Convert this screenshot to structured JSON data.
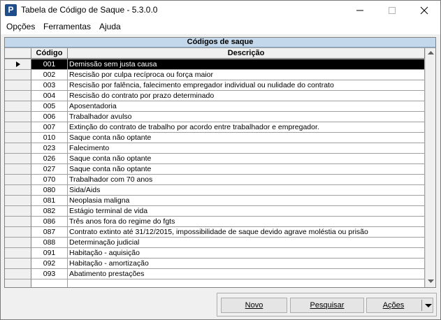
{
  "window": {
    "title": "Tabela de Código de Saque - 5.3.0.0",
    "icon": "app-logo-icon",
    "icon_letter": "P"
  },
  "menu": [
    {
      "label": "Opções"
    },
    {
      "label": "Ferramentas"
    },
    {
      "label": "Ajuda"
    }
  ],
  "grid": {
    "title": "Códigos de saque",
    "columns": {
      "code": "Código",
      "description": "Descrição"
    },
    "selected_index": 0,
    "rows": [
      {
        "code": "001",
        "description": "Demissão sem justa causa"
      },
      {
        "code": "002",
        "description": "Rescisão por culpa recíproca ou força maior"
      },
      {
        "code": "003",
        "description": "Rescisão por falência, falecimento empregador individual ou nulidade do contrato"
      },
      {
        "code": "004",
        "description": "Rescisão do contrato por prazo determinado"
      },
      {
        "code": "005",
        "description": "Aposentadoria"
      },
      {
        "code": "006",
        "description": "Trabalhador avulso"
      },
      {
        "code": "007",
        "description": "Extinção do contrato de trabalho por acordo entre trabalhador e empregador."
      },
      {
        "code": "010",
        "description": "Saque conta não optante"
      },
      {
        "code": "023",
        "description": "Falecimento"
      },
      {
        "code": "026",
        "description": "Saque conta não optante"
      },
      {
        "code": "027",
        "description": "Saque conta não optante"
      },
      {
        "code": "070",
        "description": "Trabalhador com 70 anos"
      },
      {
        "code": "080",
        "description": "Sida/Aids"
      },
      {
        "code": "081",
        "description": "Neoplasia maligna"
      },
      {
        "code": "082",
        "description": "Estágio terminal de vida"
      },
      {
        "code": "086",
        "description": "Três anos fora do regime do fgts"
      },
      {
        "code": "087",
        "description": "Contrato extinto até 31/12/2015, impossibilidade de saque devido agrave moléstia ou prisão"
      },
      {
        "code": "088",
        "description": "Determinação judicial"
      },
      {
        "code": "091",
        "description": "Habitação - aquisição"
      },
      {
        "code": "092",
        "description": "Habitação - amortização"
      },
      {
        "code": "093",
        "description": "Abatimento prestações"
      }
    ],
    "empty_rows": 1
  },
  "buttons": {
    "novo": "Novo",
    "pesquisar": "Pesquisar",
    "acoes": "Ações"
  },
  "colors": {
    "grid_title_bg": "#c3d8ea",
    "selection_bg": "#000000",
    "selection_fg": "#ffffff",
    "app_icon_bg": "#1f4e8c"
  }
}
